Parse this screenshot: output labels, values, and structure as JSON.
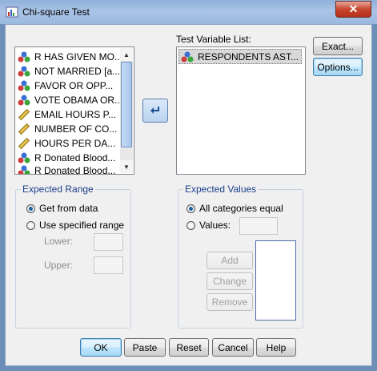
{
  "window": {
    "title": "Chi-square Test",
    "close_label": "✕"
  },
  "source_list": {
    "items": [
      {
        "label": "R HAS GIVEN MO...",
        "icon": "nominal-icon"
      },
      {
        "label": "NOT MARRIED [a...",
        "icon": "nominal-icon"
      },
      {
        "label": "FAVOR OR OPP...",
        "icon": "nominal-icon"
      },
      {
        "label": "VOTE OBAMA OR...",
        "icon": "nominal-icon"
      },
      {
        "label": "EMAIL HOURS P...",
        "icon": "scale-icon"
      },
      {
        "label": "NUMBER OF CO...",
        "icon": "scale-icon"
      },
      {
        "label": "HOURS PER DA...",
        "icon": "scale-icon"
      },
      {
        "label": "R Donated Blood...",
        "icon": "nominal-icon"
      },
      {
        "label": "R Donated Blood...",
        "icon": "nominal-icon"
      }
    ]
  },
  "move_button": {
    "icon": "arrow-left-icon"
  },
  "test_list": {
    "label": "Test Variable List:",
    "items": [
      {
        "label": "RESPONDENTS AST...",
        "icon": "nominal-icon"
      }
    ]
  },
  "side_buttons": {
    "exact": "Exact...",
    "options": "Options..."
  },
  "expected_range": {
    "legend": "Expected Range",
    "get_from_data": "Get from data",
    "use_specified": "Use specified range",
    "lower_label": "Lower:",
    "upper_label": "Upper:",
    "selected": "get_from_data"
  },
  "expected_values": {
    "legend": "Expected Values",
    "all_equal": "All categories equal",
    "values_label": "Values:",
    "add": "Add",
    "change": "Change",
    "remove": "Remove",
    "selected": "all_equal"
  },
  "bottom_buttons": {
    "ok": "OK",
    "paste": "Paste",
    "reset": "Reset",
    "cancel": "Cancel",
    "help": "Help"
  }
}
